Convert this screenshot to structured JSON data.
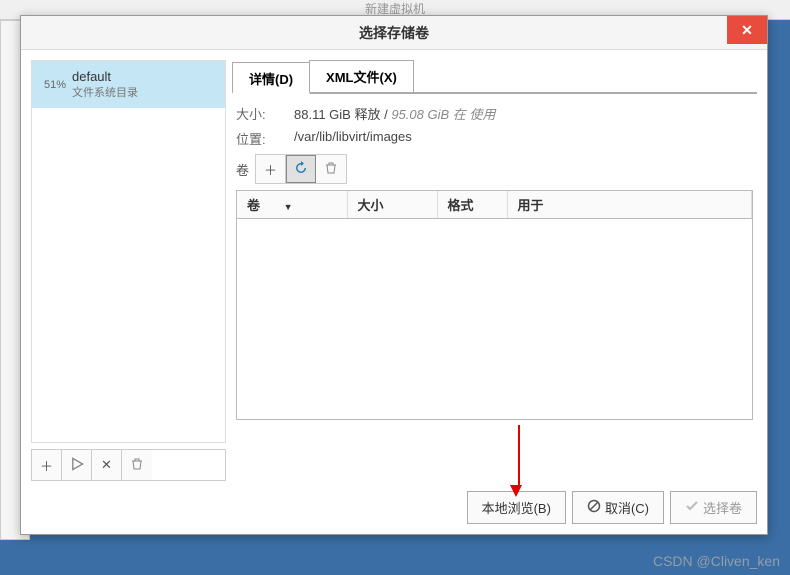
{
  "parent_window_title": "新建虚拟机",
  "dialog": {
    "title": "选择存储卷",
    "pool": {
      "percent": "51%",
      "name": "default",
      "subtitle": "文件系统目录"
    },
    "tabs": {
      "details": "详情(D)",
      "xml": "XML文件(X)"
    },
    "details": {
      "size_label": "大小:",
      "size_free": "88.11 GiB 释放 /",
      "size_used": "95.08 GiB 在 使用",
      "location_label": "位置:",
      "location_value": "/var/lib/libvirt/images",
      "volume_label": "卷"
    },
    "table": {
      "col_volume": "卷",
      "col_size": "大小",
      "col_format": "格式",
      "col_used": "用于"
    },
    "buttons": {
      "browse_local": "本地浏览(B)",
      "cancel": "取消(C)",
      "choose": "选择卷"
    }
  },
  "watermark": "CSDN @Cliven_ken"
}
